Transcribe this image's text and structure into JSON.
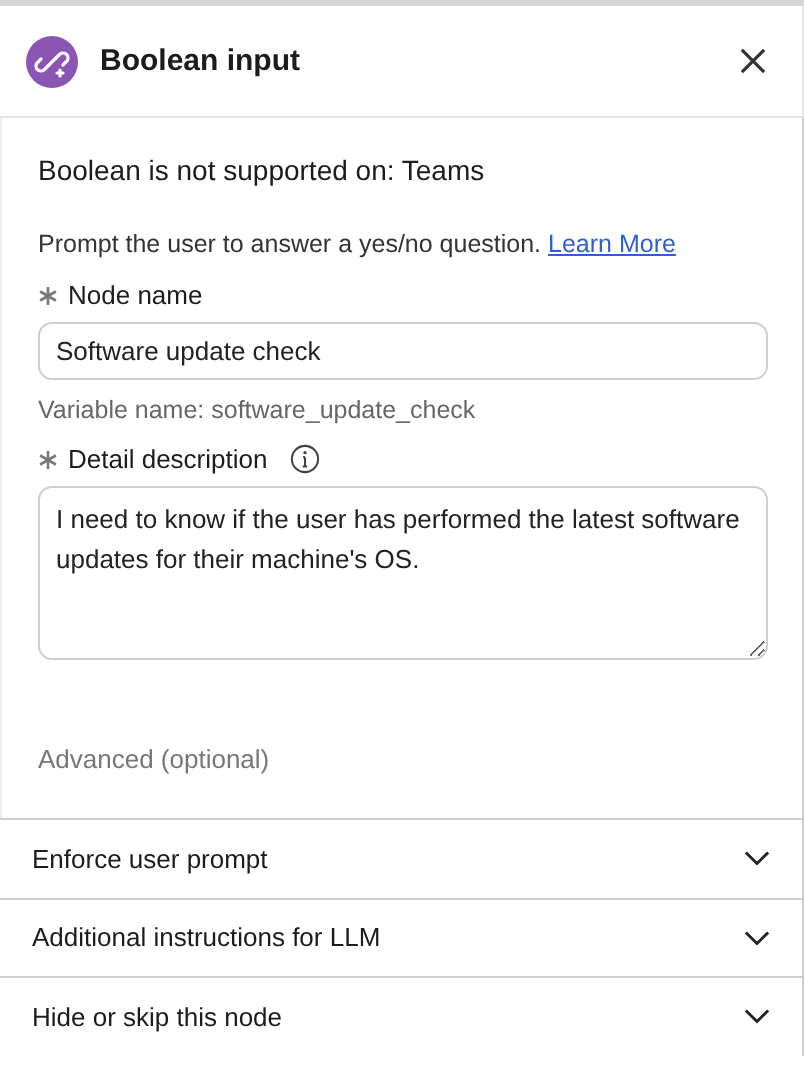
{
  "header": {
    "title": "Boolean input"
  },
  "notice": "Boolean is not supported on: Teams",
  "intro": {
    "text": "Prompt the user to answer a yes/no question.",
    "link": "Learn More"
  },
  "fields": [
    {
      "kind": "input",
      "label": "Node name",
      "required": true,
      "info": false,
      "value": "Software update check",
      "hint": "Variable name: software_update_check"
    },
    {
      "kind": "textarea",
      "label": "Detail description",
      "required": true,
      "info": true,
      "value": "I need to know if the user has performed the latest software updates for their machine's OS."
    }
  ],
  "advanced_label": "Advanced (optional)",
  "sections": [
    {
      "label": "Enforce user prompt",
      "expanded": false
    },
    {
      "label": "Additional instructions for LLM",
      "expanded": false
    },
    {
      "label": "Hide or skip this node",
      "expanded": false
    }
  ]
}
